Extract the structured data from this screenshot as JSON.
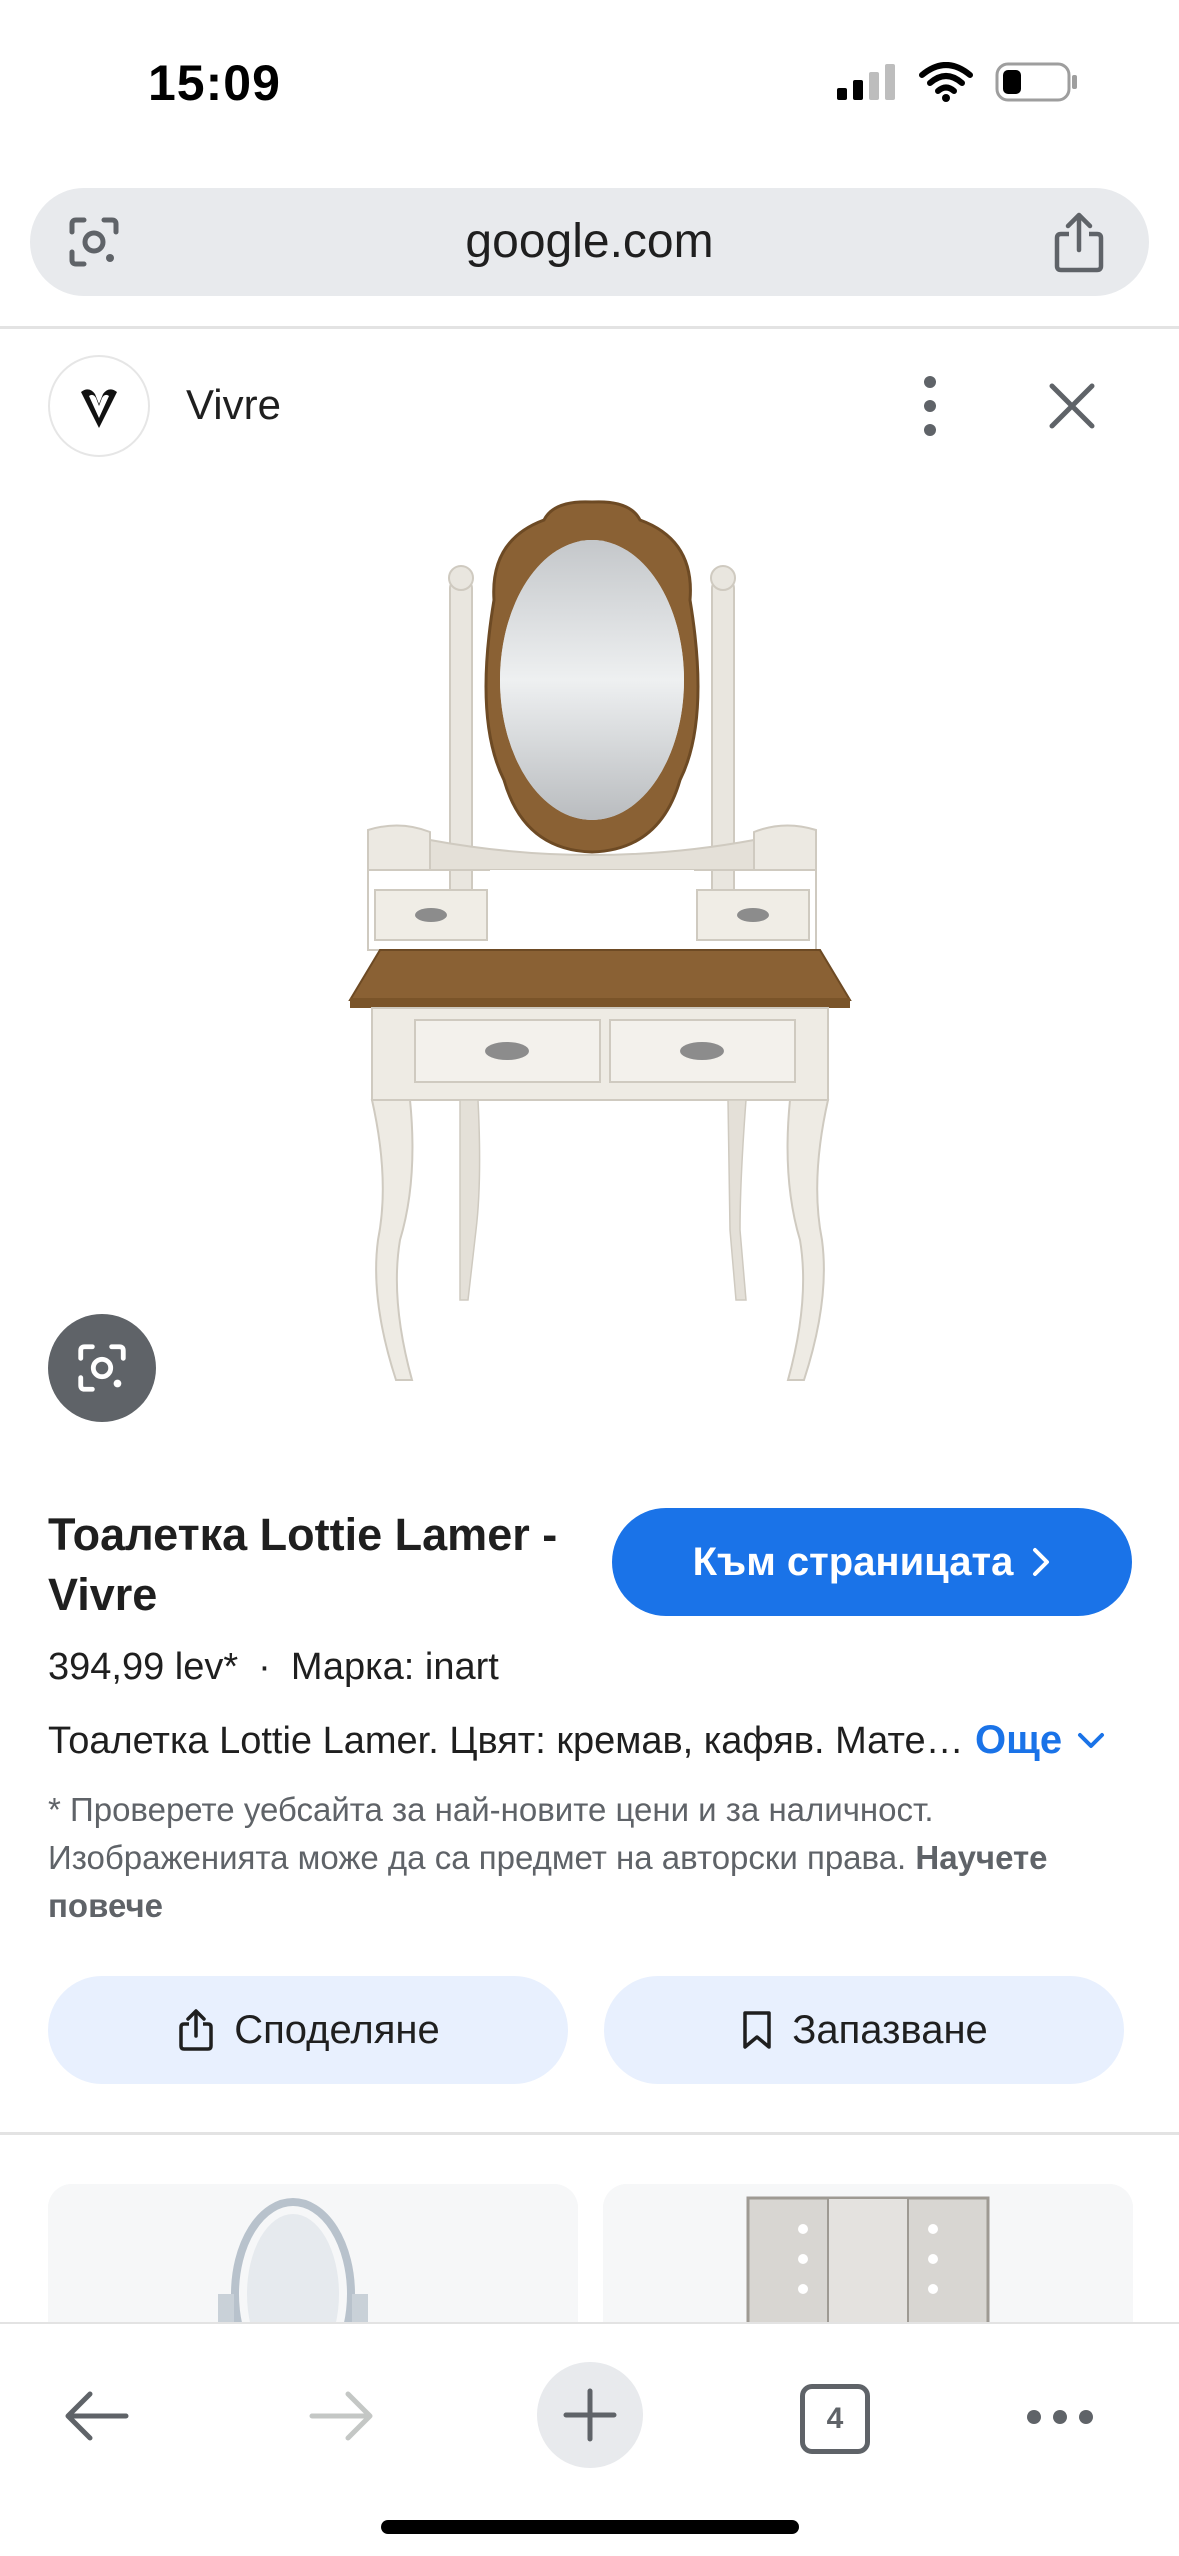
{
  "status_bar": {
    "time": "15:09"
  },
  "address_bar": {
    "url": "google.com"
  },
  "panel": {
    "site_name": "Vivre"
  },
  "product": {
    "title": "Тоалетка Lottie Lamer - Vivre",
    "visit_button": "Към страницата",
    "price": "394,99 lev*",
    "separator": "·",
    "brand": "Марка: inart",
    "description": "Тоалетка Lottie Lamer. Цвят: кремав, кафяв. Материал: ...",
    "more_link": "Още",
    "disclaimer_text": "* Проверете уебсайта за най-новите цени и за наличност. Изображенията може да са предмет на авторски права.",
    "learn_more": "Научете повече"
  },
  "actions": {
    "share": "Споделяне",
    "save": "Запазване"
  },
  "toolbar": {
    "tab_count": "4"
  },
  "colors": {
    "accent": "#1a73e8",
    "chip_bg": "#e8f0fe",
    "address_bg": "#e8eaed"
  }
}
